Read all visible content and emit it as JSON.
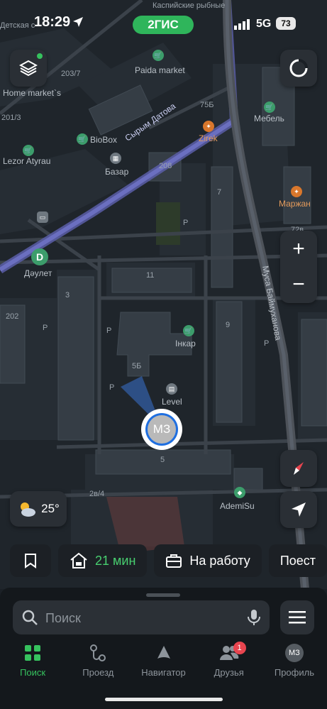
{
  "status": {
    "time": "18:29",
    "brand": "2ГИС",
    "network": "5G",
    "battery": "73"
  },
  "map": {
    "labels": {
      "street_datov": "Сырым Датова",
      "street_baimukhanova": "Муса Баймуханова",
      "caspian": "Каспийские рыбные",
      "detskaya": "Детская с",
      "paida": "Paida market",
      "home_market": "Home market`s",
      "biobox": "BioBox",
      "bazar": "Базар",
      "lezor": "Lezor Atyrau",
      "zirek": "Zirek",
      "mebel": "Мебель",
      "marzhan": "Маржан",
      "daulet": "Дәулет",
      "inkar": "Інкар",
      "level": "Level",
      "ademisu": "AdemiSu",
      "b203_7": "203/7",
      "b201_3": "201/3",
      "b75b": "75Б",
      "b208": "208",
      "b7": "7",
      "b72v": "72в",
      "b11": "11",
      "b3": "3",
      "b202": "202",
      "b9": "9",
      "b5b": "5Б",
      "b5": "5",
      "b2v4": "2в/4",
      "parking": "P"
    },
    "user_initials": "МЗ"
  },
  "controls": {
    "zoom_in": "+",
    "zoom_out": "−",
    "temperature": "25°"
  },
  "quick_routes": {
    "home_time": "21 мин",
    "work_label": "На работу",
    "more_label": "Поест"
  },
  "search": {
    "placeholder": "Поиск"
  },
  "tabs": [
    {
      "label": "Поиск",
      "icon": "search-grid-icon"
    },
    {
      "label": "Проезд",
      "icon": "route-icon"
    },
    {
      "label": "Навигатор",
      "icon": "navigator-icon"
    },
    {
      "label": "Друзья",
      "icon": "friends-icon",
      "badge": "1"
    },
    {
      "label": "Профиль",
      "icon": "profile-avatar",
      "initials": "МЗ"
    }
  ],
  "colors": {
    "accent": "#36c25e",
    "brand": "#2fb55b",
    "user": "#1f6fe0",
    "badge": "#e8454f"
  }
}
